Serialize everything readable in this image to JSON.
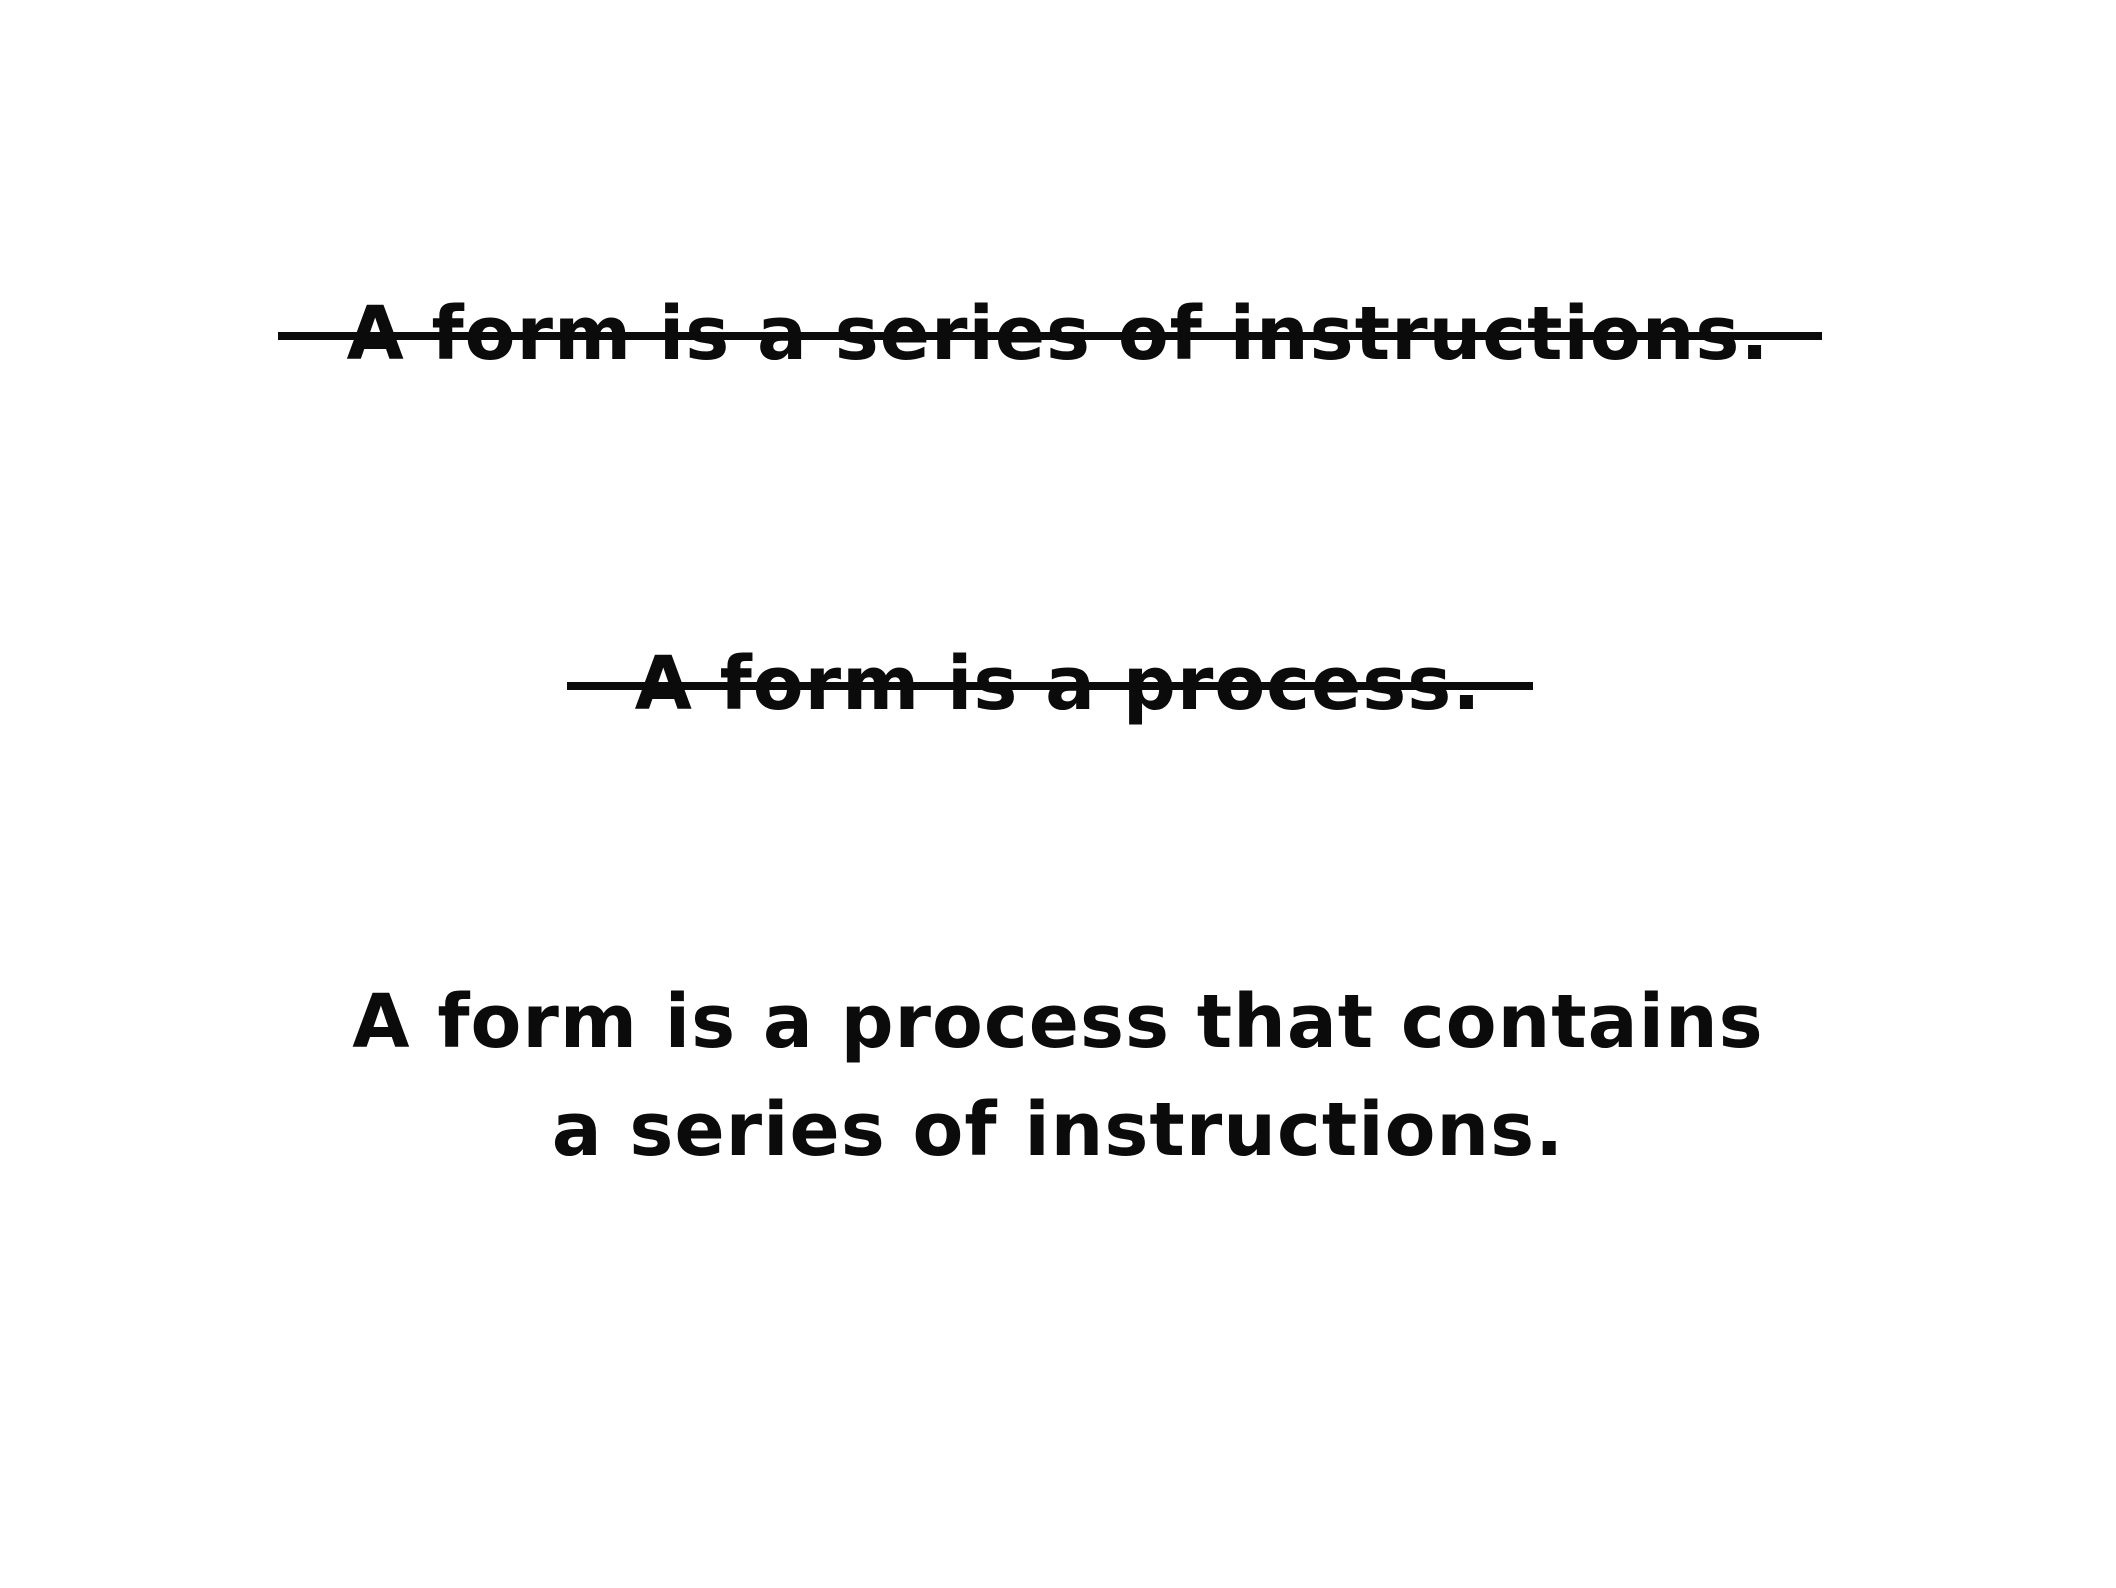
{
  "statements": {
    "first": "A form is a series of instructions.",
    "second": "A form is a process.",
    "third_line1": "A form is a process that contains",
    "third_line2": "a series of instructions."
  }
}
